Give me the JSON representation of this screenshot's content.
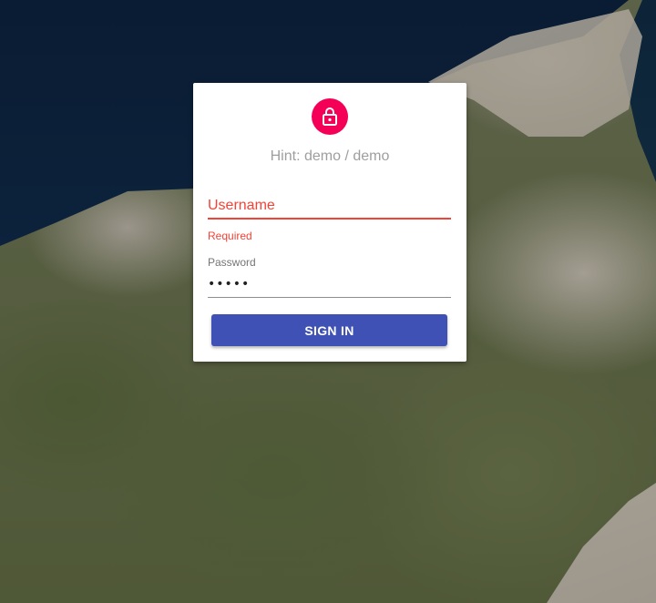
{
  "login": {
    "hint": "Hint: demo / demo",
    "username": {
      "placeholder": "Username",
      "value": "",
      "helper_text": "Required"
    },
    "password": {
      "label": "Password",
      "value": "•••••"
    },
    "submit_label": "SIGN IN"
  },
  "icons": {
    "avatar": "lock-icon"
  },
  "colors": {
    "accent": "#f50057",
    "primary": "#3f51b5",
    "error": "#f44336",
    "hint_text": "#9e9e9e"
  }
}
